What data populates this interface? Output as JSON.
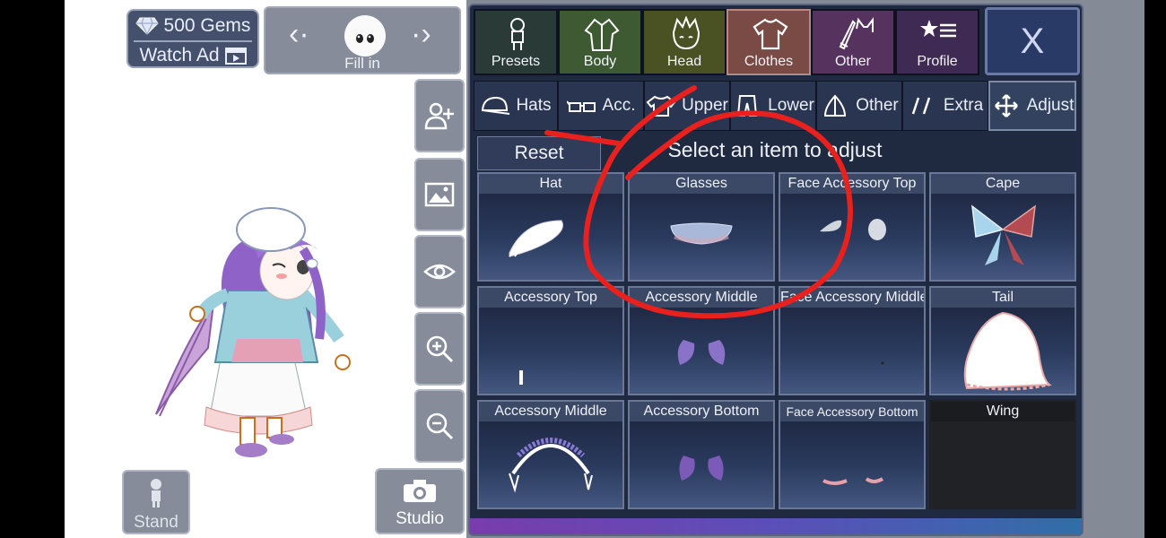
{
  "currency": {
    "gems_label": "500 Gems",
    "watch_ad_label": "Watch Ad"
  },
  "character_selector": {
    "prev_icon": "chevron-left-icon",
    "next_icon": "chevron-right-icon",
    "name": "Fill in"
  },
  "side_tools": [
    {
      "icon": "add-user-icon"
    },
    {
      "icon": "image-icon"
    },
    {
      "icon": "eye-icon"
    },
    {
      "icon": "zoom-in-icon"
    },
    {
      "icon": "zoom-out-icon"
    }
  ],
  "stand_label": "Stand",
  "studio_label": "Studio",
  "top_tabs": [
    {
      "label": "Presets",
      "bg": "#2a3b37"
    },
    {
      "label": "Body",
      "bg": "#3e5a33"
    },
    {
      "label": "Head",
      "bg": "#4a5224"
    },
    {
      "label": "Clothes",
      "bg": "#7a4a44"
    },
    {
      "label": "Other",
      "bg": "#56335e"
    },
    {
      "label": "Profile",
      "bg": "#3e2a52"
    }
  ],
  "close_label": "X",
  "sub_tabs": [
    {
      "label": "Hats"
    },
    {
      "label": "Acc."
    },
    {
      "label": "Upper"
    },
    {
      "label": "Lower"
    },
    {
      "label": "Other"
    },
    {
      "label": "Extra"
    },
    {
      "label": "Adjust"
    }
  ],
  "reset_label": "Reset",
  "hint_text": "Select an item to adjust",
  "grid": [
    {
      "title": "Hat"
    },
    {
      "title": "Glasses"
    },
    {
      "title": "Face Accessory Top"
    },
    {
      "title": "Cape"
    },
    {
      "title": "Accessory Top"
    },
    {
      "title": "Accessory Middle"
    },
    {
      "title": "Face Accessory Middle"
    },
    {
      "title": "Tail"
    },
    {
      "title": "Accessory Middle"
    },
    {
      "title": "Accessory Bottom"
    },
    {
      "title": "Face Accessory Bottom"
    },
    {
      "title": "Wing"
    }
  ],
  "colors": {
    "accent_active_tab": "#7a4a44",
    "panel_bg": "#1f2940",
    "annotation_red": "#e8211f"
  }
}
